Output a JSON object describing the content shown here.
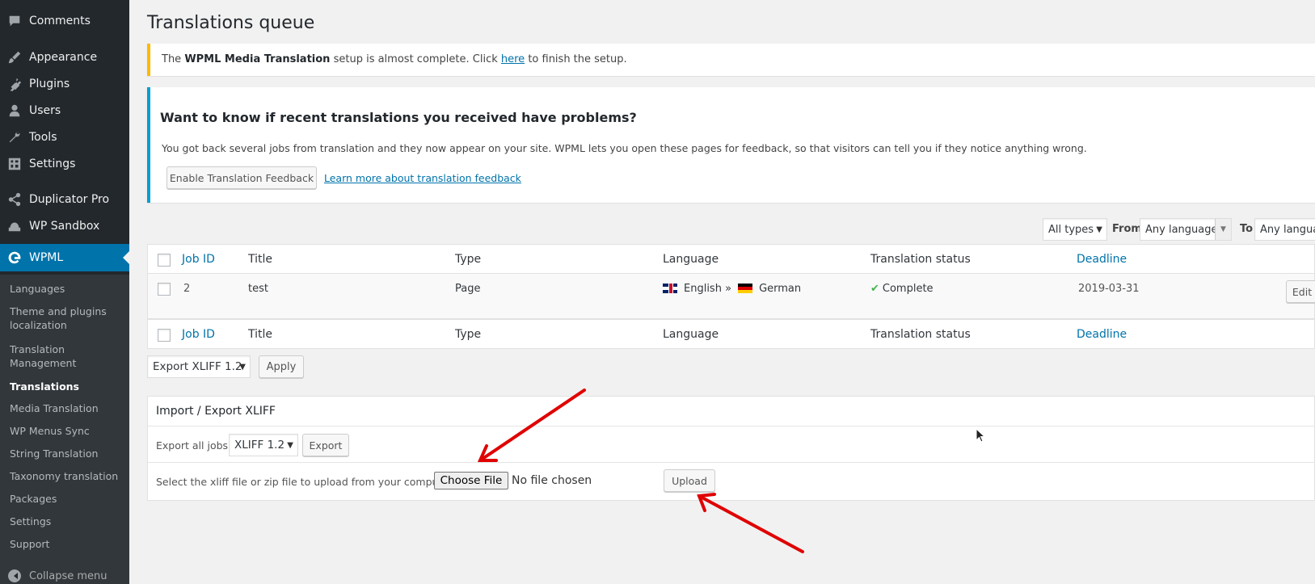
{
  "sidebar": {
    "menu": [
      {
        "label": "Comments",
        "icon": "comments-icon"
      },
      {
        "label": "Appearance",
        "icon": "paintbrush-icon"
      },
      {
        "label": "Plugins",
        "icon": "plugins-icon"
      },
      {
        "label": "Users",
        "icon": "users-icon"
      },
      {
        "label": "Tools",
        "icon": "wrench-icon"
      },
      {
        "label": "Settings",
        "icon": "settings-icon"
      },
      {
        "label": "Duplicator Pro",
        "icon": "share-icon"
      },
      {
        "label": "WP Sandbox",
        "icon": "sandbox-icon"
      },
      {
        "label": "WPML",
        "icon": "wpml-icon"
      }
    ],
    "submenu": [
      "Languages",
      "Theme and plugins localization",
      "Translation Management",
      "Translations",
      "Media Translation",
      "WP Menus Sync",
      "String Translation",
      "Taxonomy translation",
      "Packages",
      "Settings",
      "Support"
    ],
    "collapse_label": "Collapse menu"
  },
  "page_title": "Translations queue",
  "notice_media": {
    "prefix": "The ",
    "bold": "WPML Media Translation",
    "middle": " setup is almost complete. Click ",
    "link": "here",
    "suffix": " to finish the setup."
  },
  "feedback": {
    "heading": "Want to know if recent translations you received have problems?",
    "text": "You got back several jobs from translation and they now appear on your site. WPML lets you open these pages for feedback, so that visitors can tell you if they notice anything wrong.",
    "enable_button": "Enable Translation Feedback",
    "learn_link": "Learn more about translation feedback"
  },
  "filters": {
    "type": "All types",
    "from_label": "From",
    "from_value": "Any language",
    "to_label": "To",
    "to_value": "Any langua"
  },
  "table": {
    "headers": {
      "job_id": "Job ID",
      "title": "Title",
      "type": "Type",
      "language": "Language",
      "status": "Translation status",
      "deadline": "Deadline"
    },
    "rows": [
      {
        "job_id": "2",
        "title": "test",
        "type": "Page",
        "lang_from": "English",
        "lang_sep": "»",
        "lang_to": "German",
        "status": "Complete",
        "deadline": "2019-03-31",
        "action": "Edit"
      }
    ]
  },
  "bulk": {
    "select": "Export XLIFF 1.2",
    "apply": "Apply"
  },
  "xliff": {
    "title": "Import / Export XLIFF",
    "export_all_label": "Export all jobs:",
    "version": "XLIFF 1.2",
    "export_button": "Export",
    "upload_label": "Select the xliff file or zip file to upload from your computer:",
    "choose_file": "Choose File",
    "no_file": "No file chosen",
    "upload_button": "Upload"
  },
  "colors": {
    "accent": "#0073aa",
    "sidebar": "#23282d",
    "warning": "#ffb900",
    "info": "#00a0d2",
    "annotation": "#e00000"
  }
}
